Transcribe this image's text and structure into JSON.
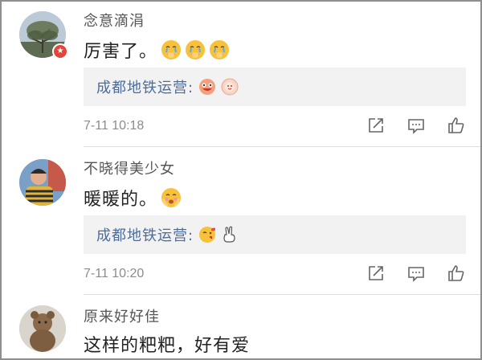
{
  "comments": [
    {
      "username": "念意滴涓",
      "text": "厉害了。",
      "emoji_icons": [
        "crying-face-icon",
        "crying-face-icon",
        "crying-face-icon"
      ],
      "reply": {
        "user": "成都地铁运营:",
        "emoji_icons": [
          "laughing-face-icon",
          "flower-face-icon"
        ]
      },
      "time": "7-11 10:18",
      "badge_icon": "star-badge-icon"
    },
    {
      "username": "不晓得美少女",
      "text": "暖暖的。",
      "emoji_icons": [
        "blushing-face-icon"
      ],
      "reply": {
        "user": "成都地铁运营:",
        "emoji_icons": [
          "kiss-face-icon",
          "victory-hand-icon"
        ]
      },
      "time": "7-11 10:20"
    },
    {
      "username": "原来好好佳",
      "text": "这样的粑粑，好有爱"
    }
  ],
  "action_icons": [
    "share-icon",
    "comment-icon",
    "like-icon"
  ],
  "colors": {
    "link": "#4a6d9c",
    "badge": "#e2453c",
    "reply_bg": "#f2f2f2",
    "emoji": "#f7c23a"
  }
}
